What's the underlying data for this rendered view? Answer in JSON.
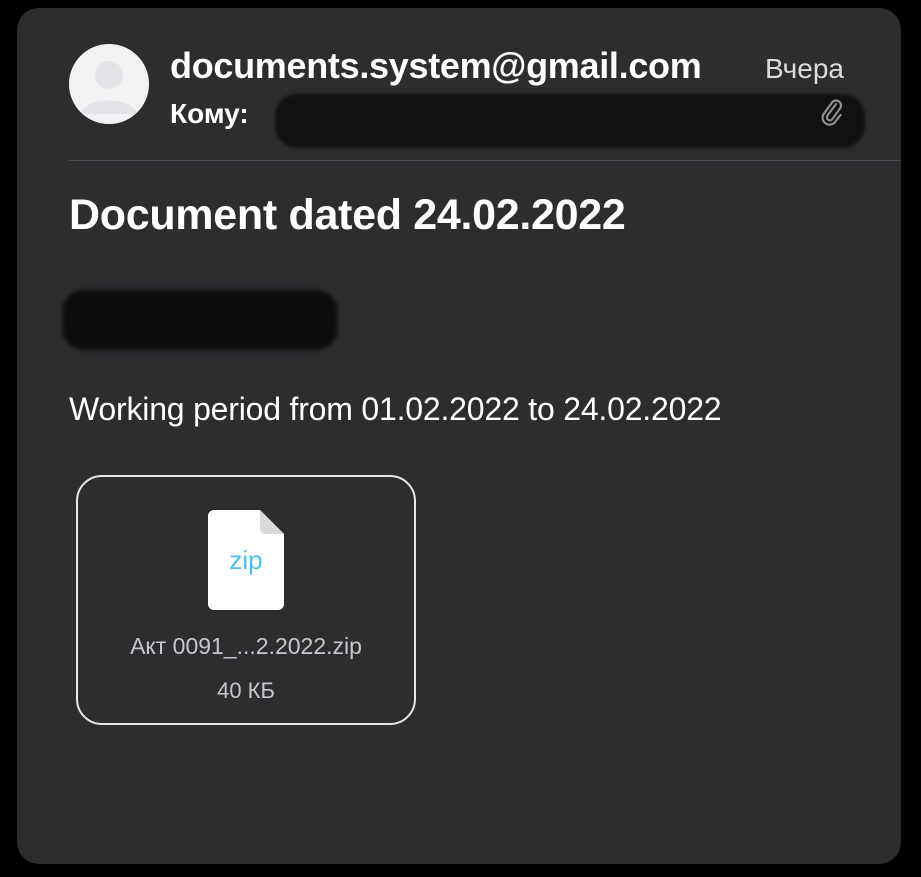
{
  "email": {
    "sender": "documents.system@gmail.com",
    "to_label": "Кому:",
    "date": "Вчера",
    "subject": "Document dated 24.02.2022",
    "body_text": "Working period from 01.02.2022 to 24.02.2022"
  },
  "attachment": {
    "extension": "zip",
    "file_name": "Акт 0091_...2.2022.zip",
    "file_size": "40 КБ"
  },
  "icons": {
    "avatar": "person-avatar-icon",
    "attachment": "paperclip-icon",
    "file": "zip-file-icon"
  },
  "colors": {
    "card_background": "#2d2d30",
    "page_background": "#000000",
    "zip_accent": "#4ec0f0"
  }
}
